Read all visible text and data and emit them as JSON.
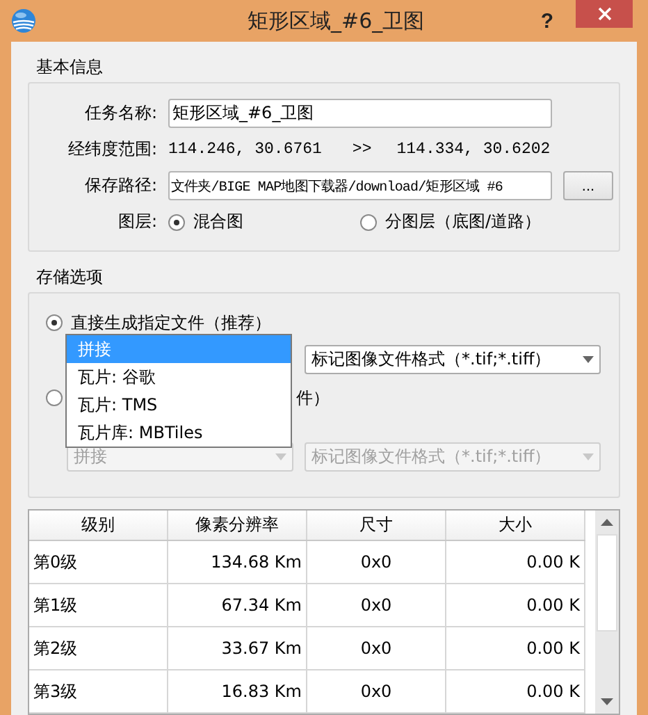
{
  "window": {
    "title": "矩形区域_#6_卫图",
    "help": "?"
  },
  "basic_info": {
    "title": "基本信息",
    "fields": [
      {
        "kind": "input",
        "label": "任务名称:",
        "value": "矩形区域_#6_卫图"
      },
      {
        "kind": "range",
        "label": "经纬度范围:",
        "from": "114.246, 30.6761",
        "separator": ">>",
        "to": "114.334, 30.6202"
      },
      {
        "kind": "path",
        "label": "保存路径:",
        "value": "文件夹/BIGE MAP地图下载器/download/矩形区域 #6",
        "button": "..."
      },
      {
        "kind": "radios",
        "label": "图层:",
        "options": [
          {
            "label": "混合图",
            "selected": true
          },
          {
            "label": "分图层（底图/道路）",
            "selected": false
          }
        ]
      }
    ]
  },
  "storage": {
    "title": "存储选项",
    "options": [
      {
        "label": "直接生成指定文件（推荐）",
        "selected": true,
        "disabled": false,
        "file_select": "标记图像文件格式（*.tif;*.tiff）"
      },
      {
        "label": "件）",
        "selected": false,
        "disabled": true,
        "format_select": "拼接",
        "file_select": "标记图像文件格式（*.tif;*.tiff）"
      }
    ]
  },
  "dropdown": {
    "items": [
      {
        "label": "拼接",
        "selected": true
      },
      {
        "label": "瓦片: 谷歌",
        "selected": false
      },
      {
        "label": "瓦片: TMS",
        "selected": false
      },
      {
        "label": "瓦片库: MBTiles",
        "selected": false
      }
    ]
  },
  "table": {
    "columns": [
      "级别",
      "像素分辨率",
      "尺寸",
      "大小"
    ],
    "rows": [
      [
        "第0级",
        "134.68 Km",
        "0x0",
        "0.00 K"
      ],
      [
        "第1级",
        "67.34 Km",
        "0x0",
        "0.00 K"
      ],
      [
        "第2级",
        "33.67 Km",
        "0x0",
        "0.00 K"
      ],
      [
        "第3级",
        "16.83 Km",
        "0x0",
        "0.00 K"
      ]
    ]
  }
}
